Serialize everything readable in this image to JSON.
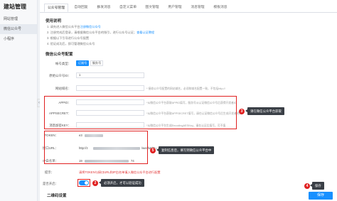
{
  "sidebar": {
    "title": "建站管理",
    "items": [
      {
        "label": "网站管理"
      },
      {
        "label": "微信公众号"
      },
      {
        "label": "小程序"
      }
    ]
  },
  "tabs": [
    {
      "label": "公众号管理",
      "active": true
    },
    {
      "label": "自动回复"
    },
    {
      "label": "群发消息"
    },
    {
      "label": "自定义菜单"
    },
    {
      "label": "图文管理"
    },
    {
      "label": "用户管理"
    },
    {
      "label": "消息管理"
    },
    {
      "label": "模板消息"
    }
  ],
  "usage": {
    "heading": "使用说明",
    "line1_prefix": "1. 请先进入微信公众平台",
    "line1_link": "注册微信公众号",
    "line2_prefix": "2. 注册完成后登录，请根据微信公众平台的指引，进行公众号认证；",
    "line2_link": "查看认证教程",
    "line3": "3. 根据以下引导进行公众号配置",
    "line4": "4. 验证成功后，即可管理微信公众号"
  },
  "config": {
    "heading": "微信公众号配置",
    "account_type_label": "帐号类型：",
    "type_subscription": "订阅号",
    "type_service": "服务号",
    "original_id_label": "原始公众号ID：",
    "original_id_value": "1",
    "website_domain_label": "网站域名：",
    "website_domain_hint": "* 接收公众号配置的网站域名，必须和域名配置一致，不包括http://",
    "appid_label": "APPID：",
    "appid_hint": "*从微信公众平台获取APPID填写，服务号从认证微信公众号后获得开发者ID",
    "appsecret_label": "APPSECRET：",
    "appsecret_hint": "*从微信公众平台获取APPSECRET填写，请在认证微信公众号后生成开发者密码",
    "encoding_key_label": "消息加密KEY：",
    "encoding_key_hint": "*从微信公众平台生成EncodingAESKey，请在认证后填写，可不填",
    "token_label": "TOKEN：",
    "token_value": "e3",
    "url_label": "接口URL：",
    "url_value_prefix": "http://z",
    "url_value_suffix": "/wechat/?r=",
    "ip_label": "IP白名单：",
    "ip_value": "19",
    "ip_value_suffix": "74",
    "notice_label": "提示：",
    "notice_text": "请将TOKEN与接口URL和IP白名单填入微信公众平台进行配置",
    "enable_label": "是否开启：",
    "qrcode_heading": "二维码设置",
    "save_label": "保存"
  },
  "callouts": [
    {
      "number": "3",
      "text": "请在微信公众平台获取"
    },
    {
      "number": "5",
      "text": "复制信息后，填写到微信公众平台中"
    },
    {
      "number": "2",
      "text": "必须开启，才可以验证成功"
    },
    {
      "number": "4",
      "text": "保存"
    }
  ],
  "colors": {
    "accent": "#1890ff",
    "highlight": "#e02020",
    "callout_bg": "#3a3f46"
  }
}
